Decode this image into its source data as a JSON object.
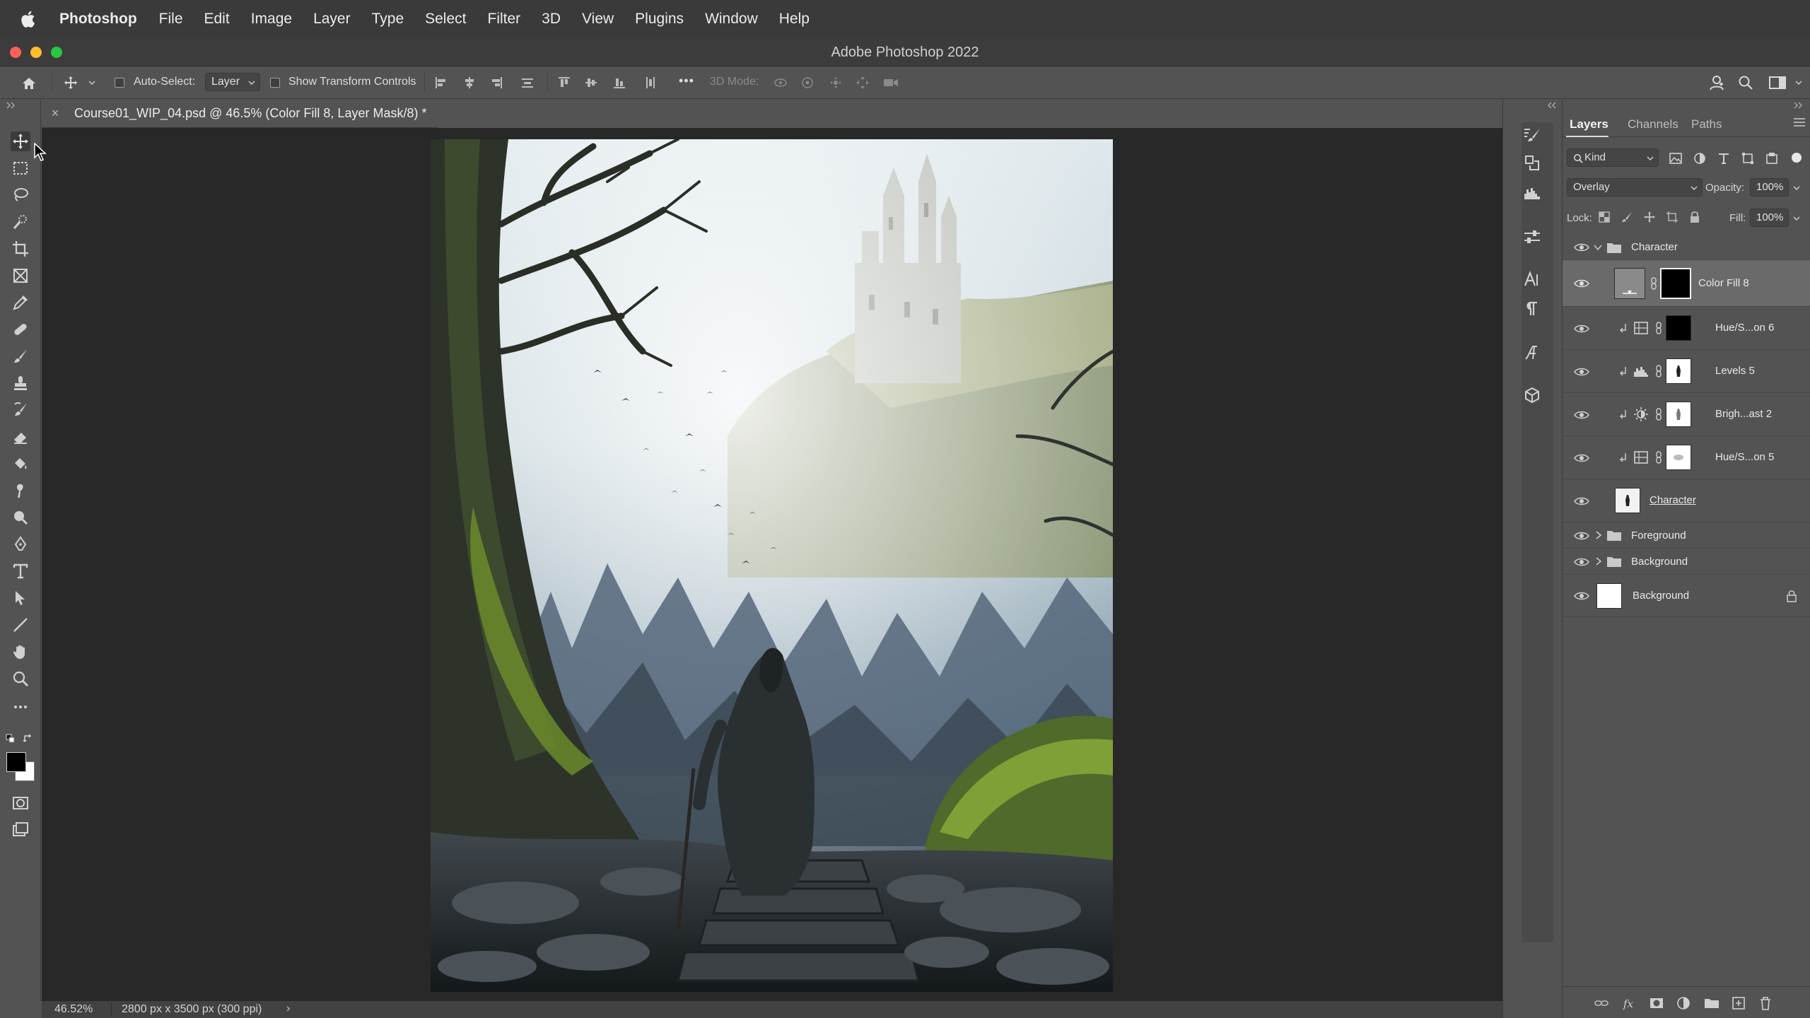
{
  "menubar": {
    "app_name": "Photoshop",
    "items": [
      "File",
      "Edit",
      "Image",
      "Layer",
      "Type",
      "Select",
      "Filter",
      "3D",
      "View",
      "Plugins",
      "Window",
      "Help"
    ]
  },
  "window": {
    "title": "Adobe Photoshop 2022"
  },
  "options_bar": {
    "auto_select_label": "Auto-Select:",
    "auto_select_value": "Layer",
    "auto_select_checked": false,
    "transform_label": "Show Transform Controls",
    "transform_checked": false,
    "more_label": "•••",
    "mode_3d_label": "3D Mode:"
  },
  "document": {
    "tab_close": "×",
    "tab_title": "Course01_WIP_04.psd @ 46.5% (Color Fill 8, Layer Mask/8) *"
  },
  "status": {
    "zoom": "46.52%",
    "info": "2800 px x 3500 px (300 ppi)",
    "arrow": "›"
  },
  "tools": [
    "move-tool",
    "marquee-tool",
    "lasso-tool",
    "quick-select-tool",
    "crop-tool",
    "frame-tool",
    "eyedropper-tool",
    "healing-tool",
    "brush-tool",
    "stamp-tool",
    "history-brush-tool",
    "eraser-tool",
    "paint-bucket-tool",
    "smudge-tool",
    "dodge-tool",
    "pen-tool",
    "type-tool",
    "path-select-tool",
    "line-tool",
    "hand-tool",
    "zoom-tool",
    "edit-toolbar",
    "swap-colors",
    "foreground-color",
    "quick-mask",
    "screen-mode"
  ],
  "colors": {
    "foreground": "#000000",
    "background": "#ffffff",
    "accent": "#1473e6"
  },
  "layers_panel": {
    "tabs": [
      "Layers",
      "Channels",
      "Paths"
    ],
    "active_tab": "Layers",
    "filter_kind": "Kind",
    "blend_mode": "Overlay",
    "opacity_label": "Opacity:",
    "opacity_value": "100%",
    "lock_label": "Lock:",
    "fill_label": "Fill:",
    "fill_value": "100%",
    "layers": [
      {
        "name": "Character",
        "type": "group",
        "expanded": true,
        "visible": true
      },
      {
        "name": "Color Fill 8",
        "type": "fill",
        "selected": true,
        "visible": true
      },
      {
        "name": "Hue/S...on 6",
        "type": "hue-saturation",
        "clipped": true,
        "visible": true
      },
      {
        "name": "Levels 5",
        "type": "levels",
        "clipped": true,
        "visible": true
      },
      {
        "name": "Brigh...ast 2",
        "type": "brightness-contrast",
        "clipped": true,
        "visible": true
      },
      {
        "name": "Hue/S...on 5",
        "type": "hue-saturation",
        "clipped": true,
        "visible": true
      },
      {
        "name": "Character",
        "type": "pixel",
        "visible": true
      },
      {
        "name": "Foreground",
        "type": "group",
        "expanded": false,
        "visible": true
      },
      {
        "name": "Background",
        "type": "group",
        "expanded": false,
        "visible": true
      },
      {
        "name": "Background",
        "type": "background",
        "locked": true,
        "visible": true
      }
    ]
  }
}
